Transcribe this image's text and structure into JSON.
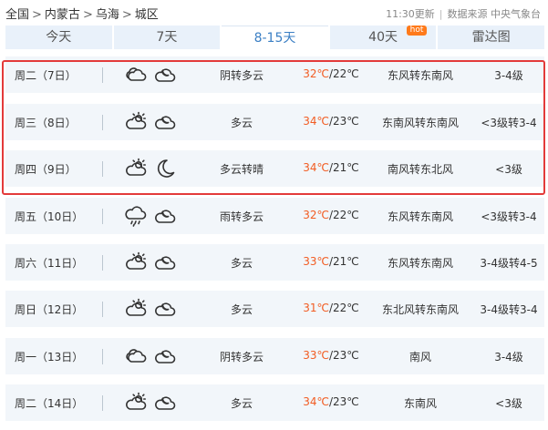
{
  "breadcrumb": [
    "全国",
    "内蒙古",
    "乌海",
    "城区"
  ],
  "breadcrumb_sep": ">",
  "update_info": {
    "time": "11:30更新",
    "source": "数据来源 中央气象台"
  },
  "tabs": [
    {
      "label": "今天",
      "active": false
    },
    {
      "label": "7天",
      "active": false
    },
    {
      "label": "8-15天",
      "active": true
    },
    {
      "label": "40天",
      "active": false,
      "badge": "hot"
    },
    {
      "label": "雷达图",
      "active": false
    }
  ],
  "days": [
    {
      "day": "周二（7日）",
      "icons": [
        "cloudy-icon",
        "partly-cloudy-night-icon"
      ],
      "desc": "阴转多云",
      "high": "32℃",
      "low": "22℃",
      "wind_dir": "东风转东南风",
      "wind_level": "3-4级"
    },
    {
      "day": "周三（8日）",
      "icons": [
        "partly-cloudy-day-icon",
        "partly-cloudy-night-icon"
      ],
      "desc": "多云",
      "high": "34℃",
      "low": "23℃",
      "wind_dir": "东南风转东南风",
      "wind_level": "<3级转3-4"
    },
    {
      "day": "周四（9日）",
      "icons": [
        "partly-cloudy-day-icon",
        "moon-icon"
      ],
      "desc": "多云转晴",
      "high": "34℃",
      "low": "21℃",
      "wind_dir": "南风转东北风",
      "wind_level": "<3级"
    },
    {
      "day": "周五（10日）",
      "icons": [
        "rain-icon",
        "partly-cloudy-night-icon"
      ],
      "desc": "雨转多云",
      "high": "32℃",
      "low": "22℃",
      "wind_dir": "东风转东南风",
      "wind_level": "<3级转3-4"
    },
    {
      "day": "周六（11日）",
      "icons": [
        "partly-cloudy-day-icon",
        "partly-cloudy-night-icon"
      ],
      "desc": "多云",
      "high": "33℃",
      "low": "21℃",
      "wind_dir": "东风转东南风",
      "wind_level": "3-4级转4-5"
    },
    {
      "day": "周日（12日）",
      "icons": [
        "partly-cloudy-day-icon",
        "partly-cloudy-night-icon"
      ],
      "desc": "多云",
      "high": "31℃",
      "low": "22℃",
      "wind_dir": "东北风转东南风",
      "wind_level": "3-4级转3-4"
    },
    {
      "day": "周一（13日）",
      "icons": [
        "cloudy-icon",
        "partly-cloudy-night-icon"
      ],
      "desc": "阴转多云",
      "high": "33℃",
      "low": "23℃",
      "wind_dir": "南风",
      "wind_level": "3-4级"
    },
    {
      "day": "周二（14日）",
      "icons": [
        "partly-cloudy-day-icon",
        "partly-cloudy-night-icon"
      ],
      "desc": "多云",
      "high": "34℃",
      "low": "23℃",
      "wind_dir": "东南风",
      "wind_level": "<3级"
    }
  ],
  "colors": {
    "accent": "#3b7fc4",
    "high_temp": "#f25c22",
    "highlight_border": "#e33a3a",
    "row_bg": "#f2f6fa",
    "tab_bg": "#e9f1fa"
  }
}
